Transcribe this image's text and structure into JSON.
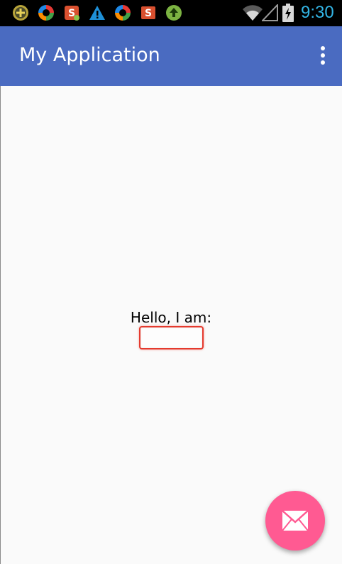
{
  "status_bar": {
    "time": "9:30",
    "time_color": "#33b5e5",
    "notification_icons": [
      "battery-saver-icon",
      "sync-icon",
      "app-s-icon",
      "warning-icon",
      "sync-icon",
      "app-s-icon",
      "upload-icon"
    ],
    "system_icons": [
      "wifi-icon",
      "cell-signal-icon",
      "battery-charging-icon"
    ]
  },
  "toolbar": {
    "title": "My Application",
    "background_color": "#4a6bc1",
    "menu_icon": "overflow-menu-icon"
  },
  "main": {
    "greeting_label": "Hello, I am:",
    "name_input": {
      "value": "",
      "placeholder": "",
      "border_color": "#e53a2e"
    }
  },
  "fab": {
    "icon": "email-icon",
    "color": "#ff5a92"
  }
}
